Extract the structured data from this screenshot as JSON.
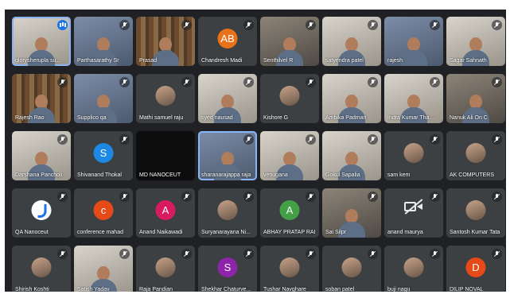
{
  "meeting": {
    "colors": {
      "background": "#202124",
      "tile": "#3c4043",
      "speaking": "#1a73e8",
      "name_text": "#ffffff"
    },
    "participants": [
      {
        "name": "glorysherupla su...",
        "kind": "video",
        "tone": "light",
        "mic": "speaking",
        "highlight": true
      },
      {
        "name": "Parthasarathy Sr",
        "kind": "video",
        "tone": "blue",
        "mic": "muted"
      },
      {
        "name": "Prasad",
        "kind": "video",
        "tone": "shelf",
        "mic": "muted"
      },
      {
        "name": "Chandresh Madi",
        "kind": "avatar",
        "avatar": "AB",
        "avatar_color": "#e8711a",
        "mic": "muted"
      },
      {
        "name": "Senthilvel R",
        "kind": "video",
        "tone": "dark",
        "mic": "muted"
      },
      {
        "name": "satyendra patel",
        "kind": "video",
        "tone": "light",
        "mic": "muted"
      },
      {
        "name": "rajesh",
        "kind": "video",
        "tone": "blue",
        "mic": "muted"
      },
      {
        "name": "Sagar Sahnath",
        "kind": "video",
        "tone": "light",
        "mic": "muted"
      },
      {
        "name": "Rajesh Rao",
        "kind": "video",
        "tone": "shelf",
        "mic": "muted"
      },
      {
        "name": "Supplico qa",
        "kind": "video",
        "tone": "blue",
        "mic": "muted"
      },
      {
        "name": "Mathi samuel raju",
        "kind": "avatar",
        "avatar": "",
        "avatar_color": "photo",
        "mic": "muted"
      },
      {
        "name": "syed nausad",
        "kind": "video",
        "tone": "light",
        "mic": "muted"
      },
      {
        "name": "Kishore G",
        "kind": "avatar",
        "avatar": "",
        "avatar_color": "photo",
        "mic": "muted"
      },
      {
        "name": "Ambika Padman",
        "kind": "video",
        "tone": "light",
        "mic": "muted"
      },
      {
        "name": "Indra Kumar Tha...",
        "kind": "video",
        "tone": "light",
        "mic": "muted"
      },
      {
        "name": "Nanuk Ali On C",
        "kind": "video",
        "tone": "dark",
        "mic": "muted"
      },
      {
        "name": "Darshana Pancholi",
        "kind": "video",
        "tone": "light",
        "mic": "muted"
      },
      {
        "name": "Shivanand Thokal",
        "kind": "avatar",
        "avatar": "S",
        "avatar_color": "#1e88e5",
        "mic": "muted"
      },
      {
        "name": "MD NANOCEUT",
        "kind": "black",
        "mic": "none"
      },
      {
        "name": "sharanarajappa raja",
        "kind": "video",
        "tone": "blue",
        "mic": "muted",
        "highlight": true
      },
      {
        "name": "venugana",
        "kind": "video",
        "tone": "light",
        "mic": "muted"
      },
      {
        "name": "Gokul Sapalia",
        "kind": "video",
        "tone": "light",
        "mic": "muted"
      },
      {
        "name": "sam kem",
        "kind": "avatar",
        "avatar": "",
        "avatar_color": "photo",
        "mic": "muted"
      },
      {
        "name": "AK COMPUTERS",
        "kind": "avatar",
        "avatar": "",
        "avatar_color": "photo",
        "mic": "muted"
      },
      {
        "name": "QA Nanoceut",
        "kind": "avatar",
        "avatar": "",
        "avatar_color": "logo",
        "mic": "muted"
      },
      {
        "name": "conference mahad",
        "kind": "avatar",
        "avatar": "c",
        "avatar_color": "#e64a19",
        "mic": "muted"
      },
      {
        "name": "Anand Naikawadi",
        "kind": "avatar",
        "avatar": "A",
        "avatar_color": "#d81b60",
        "mic": "muted"
      },
      {
        "name": "Suryanarayana Ni...",
        "kind": "avatar",
        "avatar": "",
        "avatar_color": "photo",
        "mic": "muted"
      },
      {
        "name": "ABHAY PRATAP RAI",
        "kind": "avatar",
        "avatar": "A",
        "avatar_color": "#43a047",
        "mic": "muted"
      },
      {
        "name": "Sai Silpr",
        "kind": "video",
        "tone": "dark",
        "mic": "muted"
      },
      {
        "name": "anand maurya",
        "kind": "camoff",
        "mic": "muted"
      },
      {
        "name": "Santosh Kumar Tata",
        "kind": "avatar",
        "avatar": "",
        "avatar_color": "photo",
        "mic": "muted"
      },
      {
        "name": "Shirish Koshti",
        "kind": "avatar",
        "avatar": "",
        "avatar_color": "photo",
        "mic": "muted"
      },
      {
        "name": "Satish Yadav",
        "kind": "video",
        "tone": "light",
        "mic": "muted"
      },
      {
        "name": "Raja Pandian",
        "kind": "avatar",
        "avatar": "",
        "avatar_color": "photo",
        "mic": "muted"
      },
      {
        "name": "Shekhar Chaturve...",
        "kind": "avatar",
        "avatar": "S",
        "avatar_color": "#8e24aa",
        "mic": "muted"
      },
      {
        "name": "Tushar Navghare",
        "kind": "avatar",
        "avatar": "",
        "avatar_color": "photo",
        "mic": "muted"
      },
      {
        "name": "soban patel",
        "kind": "avatar",
        "avatar": "",
        "avatar_color": "photo",
        "mic": "muted"
      },
      {
        "name": "buji nagu",
        "kind": "avatar",
        "avatar": "",
        "avatar_color": "photo",
        "mic": "muted"
      },
      {
        "name": "DILIP NOVAL",
        "kind": "avatar",
        "avatar": "D",
        "avatar_color": "#e64a19",
        "mic": "muted"
      }
    ]
  }
}
